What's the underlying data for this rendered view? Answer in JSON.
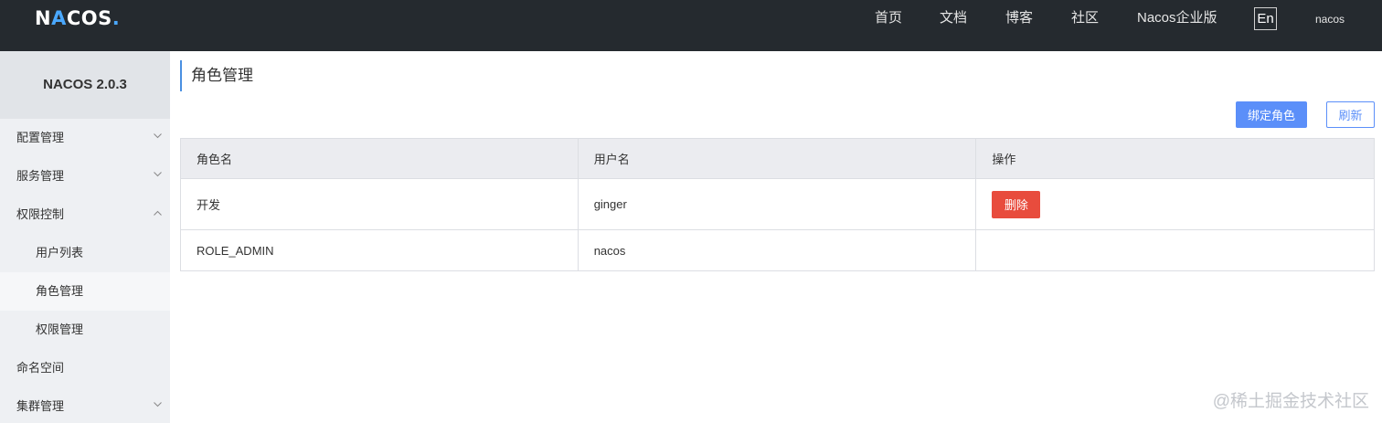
{
  "topbar": {
    "logo": {
      "part1": "N",
      "accent": "A",
      "part2": "COS",
      "dot": "."
    },
    "nav": [
      "首页",
      "文档",
      "博客",
      "社区",
      "Nacos企业版"
    ],
    "lang": "En",
    "user": "nacos"
  },
  "sidebar": {
    "brand": "NACOS 2.0.3",
    "items": [
      {
        "label": "配置管理"
      },
      {
        "label": "服务管理"
      },
      {
        "label": "权限控制"
      },
      {
        "label": "用户列表"
      },
      {
        "label": "角色管理"
      },
      {
        "label": "权限管理"
      },
      {
        "label": "命名空间"
      },
      {
        "label": "集群管理"
      }
    ]
  },
  "page": {
    "title": "角色管理",
    "bind_role_label": "绑定角色",
    "refresh_label": "刷新"
  },
  "table": {
    "headers": [
      "角色名",
      "用户名",
      "操作"
    ],
    "rows": [
      {
        "role": "开发",
        "user": "ginger",
        "action": "删除"
      },
      {
        "role": "ROLE_ADMIN",
        "user": "nacos"
      }
    ]
  },
  "watermark": "@稀土掘金技术社区",
  "colors": {
    "topbar_bg": "#252a2f",
    "primary": "#5b8ff9",
    "danger": "#e84c3d"
  }
}
